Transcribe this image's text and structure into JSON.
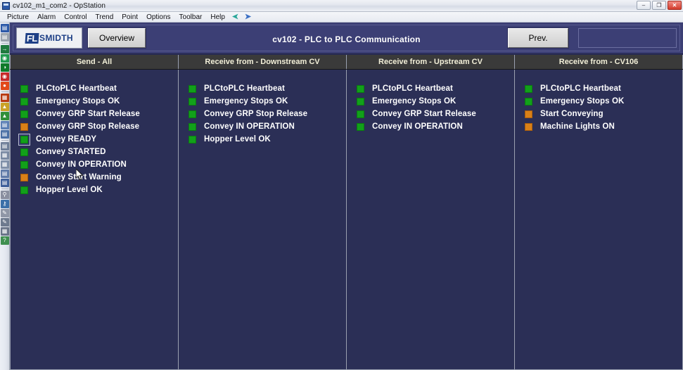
{
  "window": {
    "title": "cv102_m1_com2 - OpStation",
    "icon": "opstation-icon",
    "buttons": {
      "minimize": "–",
      "restore": "❐",
      "close": "✕"
    }
  },
  "menubar": {
    "items": [
      {
        "label": "Picture"
      },
      {
        "label": "Alarm"
      },
      {
        "label": "Control"
      },
      {
        "label": "Trend"
      },
      {
        "label": "Point"
      },
      {
        "label": "Options"
      },
      {
        "label": "Toolbar"
      },
      {
        "label": "Help"
      }
    ],
    "nav": {
      "back": "back-arrow-icon",
      "forward": "forward-arrow-icon",
      "back_glyph": "➡",
      "forward_glyph": "➡"
    }
  },
  "left_toolbar": {
    "icons": [
      {
        "name": "save-picture-icon",
        "color": "#2b58a8",
        "glyph": "▤"
      },
      {
        "name": "disk-icon",
        "color": "#9aa3ae",
        "glyph": "▤"
      },
      {
        "name": "login-icon",
        "color": "#1f7a3f",
        "glyph": "→"
      },
      {
        "name": "operator-icon",
        "color": "#1f9a4f",
        "glyph": "◉"
      },
      {
        "name": "start-icon",
        "color": "#0f7a2a",
        "glyph": "◑"
      },
      {
        "name": "stop-icon",
        "color": "#c62828",
        "glyph": "◉"
      },
      {
        "name": "alarm-icon",
        "color": "#e24a1a",
        "glyph": "●"
      },
      {
        "name": "alarm-summary-icon",
        "color": "#b83a10",
        "glyph": "▦"
      },
      {
        "name": "event-icon",
        "color": "#c9a227",
        "glyph": "▲"
      },
      {
        "name": "trend-icon",
        "color": "#2f8f3a",
        "glyph": "▲"
      },
      {
        "name": "report-icon",
        "color": "#5b7fb5",
        "glyph": "▤"
      },
      {
        "name": "print-icon",
        "color": "#4a6fa5",
        "glyph": "▤"
      },
      {
        "name": "detail-icon",
        "color": "#6f7f99",
        "glyph": "▤"
      },
      {
        "name": "group-icon",
        "color": "#7a8aa3",
        "glyph": "▦"
      },
      {
        "name": "faceplate-icon",
        "color": "#7f8fa8",
        "glyph": "▦"
      },
      {
        "name": "notes-icon",
        "color": "#5f7aa8",
        "glyph": "▤"
      },
      {
        "name": "point-detail-icon",
        "color": "#3e5f9a",
        "glyph": "▤"
      },
      {
        "name": "search-icon",
        "color": "#8a8fa0",
        "glyph": "⚲"
      },
      {
        "name": "key-icon",
        "color": "#3b6fa8",
        "glyph": "⚷"
      },
      {
        "name": "tune-icon",
        "color": "#8f96a6",
        "glyph": "✎"
      },
      {
        "name": "edit-icon",
        "color": "#6e7a8e",
        "glyph": "✎"
      },
      {
        "name": "window-icon",
        "color": "#6a7488",
        "glyph": "▦"
      },
      {
        "name": "help-icon",
        "color": "#3f8f4f",
        "glyph": "?"
      }
    ]
  },
  "header": {
    "logo": {
      "name": "flsmidth-logo",
      "fl": "FL",
      "smidth": "SMIDTH"
    },
    "overview_button": "Overview",
    "screen_title": "cv102 - PLC to PLC Communication",
    "prev_button": "Prev.",
    "blank_panel": ""
  },
  "columns": [
    {
      "header": "Send - All",
      "rows": [
        {
          "label": "PLCtoPLC Heartbeat",
          "state": "green",
          "selected": false
        },
        {
          "label": "Emergency Stops OK",
          "state": "green",
          "selected": false
        },
        {
          "label": "Convey GRP Start Release",
          "state": "green",
          "selected": false
        },
        {
          "label": "Convey GRP Stop Release",
          "state": "orange",
          "selected": false
        },
        {
          "label": "Convey READY",
          "state": "green",
          "selected": true
        },
        {
          "label": "Convey STARTED",
          "state": "green",
          "selected": false
        },
        {
          "label": "Convey IN OPERATION",
          "state": "green",
          "selected": false
        },
        {
          "label": "Convey Start Warning",
          "state": "orange",
          "selected": false
        },
        {
          "label": "Hopper Level OK",
          "state": "green",
          "selected": false
        }
      ]
    },
    {
      "header": "Receive from - Downstream CV",
      "rows": [
        {
          "label": "PLCtoPLC Heartbeat",
          "state": "green",
          "selected": false
        },
        {
          "label": "Emergency Stops OK",
          "state": "green",
          "selected": false
        },
        {
          "label": "Convey GRP Stop Release",
          "state": "green",
          "selected": false
        },
        {
          "label": "Convey IN OPERATION",
          "state": "green",
          "selected": false
        },
        {
          "label": "Hopper Level OK",
          "state": "green",
          "selected": false
        }
      ]
    },
    {
      "header": "Receive from - Upstream CV",
      "rows": [
        {
          "label": "PLCtoPLC Heartbeat",
          "state": "green",
          "selected": false
        },
        {
          "label": "Emergency Stops OK",
          "state": "green",
          "selected": false
        },
        {
          "label": "Convey GRP Start Release",
          "state": "green",
          "selected": false
        },
        {
          "label": "Convey IN OPERATION",
          "state": "green",
          "selected": false
        }
      ]
    },
    {
      "header": "Receive from - CV106",
      "rows": [
        {
          "label": "PLCtoPLC Heartbeat",
          "state": "green",
          "selected": false
        },
        {
          "label": "Emergency Stops OK",
          "state": "green",
          "selected": false
        },
        {
          "label": "Start Conveying",
          "state": "orange",
          "selected": false
        },
        {
          "label": "Machine Lights ON",
          "state": "orange",
          "selected": false
        }
      ]
    }
  ],
  "colors": {
    "panel_blue": "#2b2f56",
    "header_blue": "#3c3f75",
    "lamp_green": "#12a01a",
    "lamp_orange": "#d98018",
    "column_header_bg": "#3a3a3a",
    "column_header_text": "#f2efd8",
    "logo_blue": "#1d3f86"
  }
}
